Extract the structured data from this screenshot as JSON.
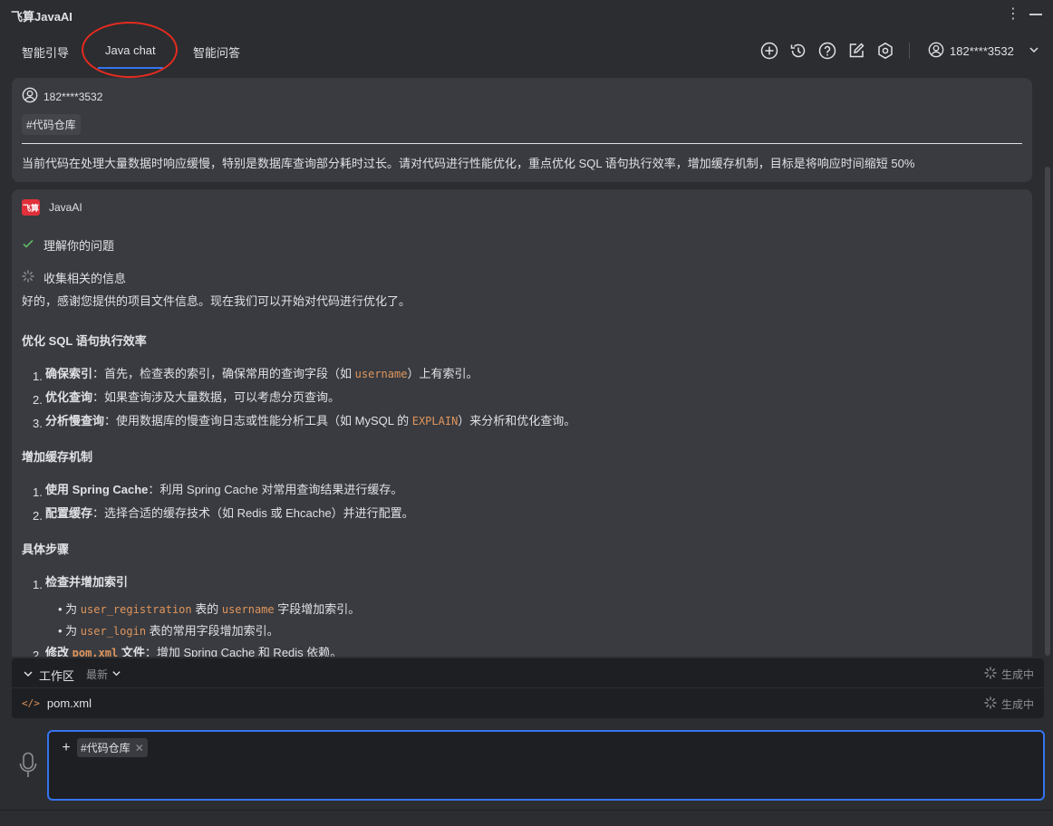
{
  "window": {
    "title": "飞算JavaAI"
  },
  "tabs": [
    {
      "label": "智能引导"
    },
    {
      "label": "Java chat"
    },
    {
      "label": "智能问答"
    }
  ],
  "toolbar": {
    "icons": [
      "new-chat-icon",
      "history-icon",
      "help-icon",
      "edit-icon",
      "settings-icon"
    ],
    "user_label": "182****3532"
  },
  "user_message": {
    "username": "182****3532",
    "tag": "#代码仓库",
    "text": "当前代码在处理大量数据时响应缓慢，特别是数据库查询部分耗时过长。请对代码进行性能优化，重点优化 SQL 语句执行效率，增加缓存机制，目标是将响应时间缩短 50%"
  },
  "ai_message": {
    "name": "JavaAI",
    "logo_text": "飞算",
    "steps": [
      {
        "label": "理解你的问题",
        "status": "done"
      },
      {
        "label": "收集相关的信息",
        "status": "loading"
      }
    ],
    "intro": "好的，感谢您提供的项目文件信息。现在我们可以开始对代码进行优化了。",
    "section1": {
      "title": "优化 SQL 语句执行效率",
      "items": [
        {
          "bold": "确保索引",
          "text_a": "：首先，检查表的索引，确保常用的查询字段（如 ",
          "code": "username",
          "text_b": "）上有索引。"
        },
        {
          "bold": "优化查询",
          "text_a": "：如果查询涉及大量数据，可以考虑分页查询。"
        },
        {
          "bold": "分析慢查询",
          "text_a": "：使用数据库的慢查询日志或性能分析工具（如 MySQL 的 ",
          "code": "EXPLAIN",
          "text_b": "）来分析和优化查询。"
        }
      ]
    },
    "section2": {
      "title": "增加缓存机制",
      "items": [
        {
          "bold": "使用 Spring Cache",
          "text_a": "：利用 Spring Cache 对常用查询结果进行缓存。"
        },
        {
          "bold": "配置缓存",
          "text_a": "：选择合适的缓存技术（如 Redis 或 Ehcache）并进行配置。"
        }
      ]
    },
    "section3": {
      "title": "具体步骤",
      "item1": "检查并增加索引",
      "sub1": {
        "prefix": "为 ",
        "code1": "user_registration",
        "mid": " 表的 ",
        "code2": "username",
        "suffix": " 字段增加索引。"
      },
      "sub2": {
        "prefix": "为 ",
        "code1": "user_login",
        "suffix": " 表的常用字段增加索引。"
      },
      "item2_bold_a": "修改 ",
      "item2_code": "pom.xml",
      "item2_bold_b": " 文件",
      "item2_text": "：增加 Spring Cache 和 Redis 依赖。"
    }
  },
  "workarea": {
    "title": "工作区",
    "sort": "最新",
    "status": "生成中",
    "file": {
      "name": "pom.xml",
      "status": "生成中"
    }
  },
  "input": {
    "chip": "#代码仓库"
  },
  "colors": {
    "accent": "#3574f0",
    "annotation": "#e52b20",
    "code": "#e0955c",
    "success": "#5fb865"
  }
}
